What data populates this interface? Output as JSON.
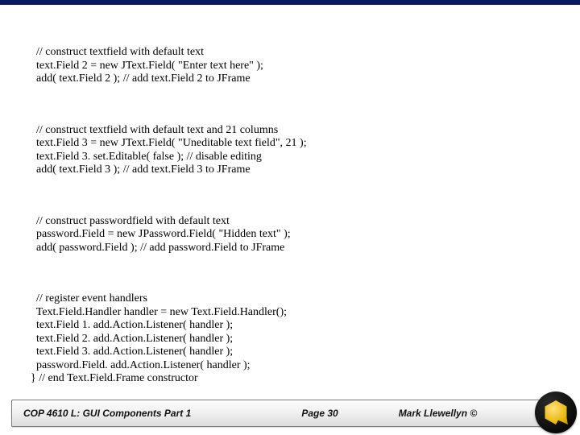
{
  "code": {
    "block1": {
      "l1": "  // construct textfield with default text",
      "l2": "  text.Field 2 = new JText.Field( \"Enter text here\" );",
      "l3": "  add( text.Field 2 ); // add text.Field 2 to JFrame"
    },
    "block2": {
      "l1": "  // construct textfield with default text and 21 columns",
      "l2": "  text.Field 3 = new JText.Field( \"Uneditable text field\", 21 );",
      "l3": "  text.Field 3. set.Editable( false ); // disable editing",
      "l4": "  add( text.Field 3 ); // add text.Field 3 to JFrame"
    },
    "block3": {
      "l1": "  // construct passwordfield with default text",
      "l2": "  password.Field = new JPassword.Field( \"Hidden text\" );",
      "l3": "  add( password.Field ); // add password.Field to JFrame"
    },
    "block4": {
      "l1": "  // register event handlers",
      "l2": "  Text.Field.Handler handler = new Text.Field.Handler();",
      "l3": "  text.Field 1. add.Action.Listener( handler );",
      "l4": "  text.Field 2. add.Action.Listener( handler );",
      "l5": "  text.Field 3. add.Action.Listener( handler );",
      "l6": "  password.Field. add.Action.Listener( handler );",
      "l7": "} // end Text.Field.Frame constructor"
    }
  },
  "footer": {
    "left": "COP 4610 L: GUI Components Part 1",
    "mid": "Page 30",
    "right": "Mark Llewellyn ©"
  }
}
